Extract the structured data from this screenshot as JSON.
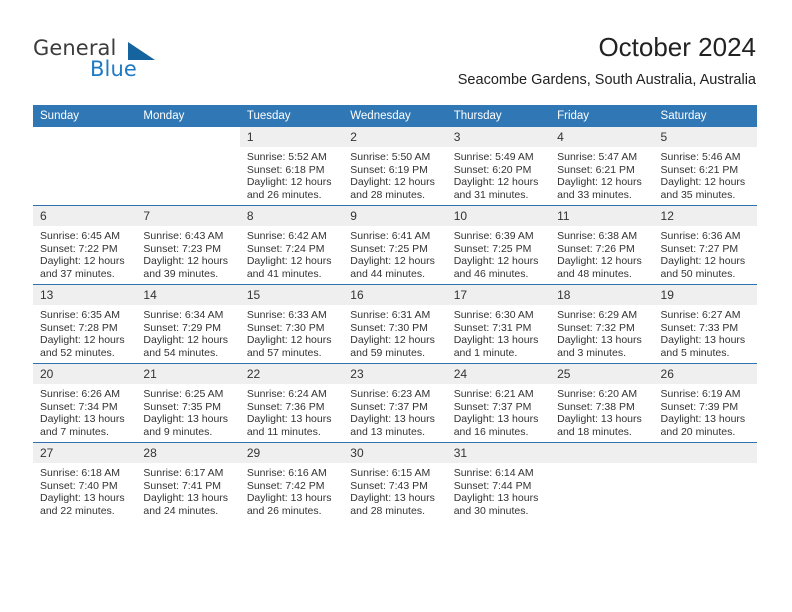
{
  "brand": {
    "name_top": "General",
    "name_bottom": "Blue",
    "accent_color": "#15639f",
    "blue_text_color": "#1f7ac4"
  },
  "header": {
    "title": "October 2024",
    "subtitle": "Seacombe Gardens, South Australia, Australia"
  },
  "theme": {
    "header_band": "#3077b5",
    "row_divider": "#2e73b0",
    "day_number_band": "#efefef"
  },
  "weekday_headers": [
    "Sunday",
    "Monday",
    "Tuesday",
    "Wednesday",
    "Thursday",
    "Friday",
    "Saturday"
  ],
  "weeks": [
    {
      "shaded_empty": false,
      "days": [
        {
          "empty": true
        },
        {
          "empty": true
        },
        {
          "day": "1",
          "sunrise": "Sunrise: 5:52 AM",
          "sunset": "Sunset: 6:18 PM",
          "daylight_line1": "Daylight: 12 hours",
          "daylight_line2": "and 26 minutes."
        },
        {
          "day": "2",
          "sunrise": "Sunrise: 5:50 AM",
          "sunset": "Sunset: 6:19 PM",
          "daylight_line1": "Daylight: 12 hours",
          "daylight_line2": "and 28 minutes."
        },
        {
          "day": "3",
          "sunrise": "Sunrise: 5:49 AM",
          "sunset": "Sunset: 6:20 PM",
          "daylight_line1": "Daylight: 12 hours",
          "daylight_line2": "and 31 minutes."
        },
        {
          "day": "4",
          "sunrise": "Sunrise: 5:47 AM",
          "sunset": "Sunset: 6:21 PM",
          "daylight_line1": "Daylight: 12 hours",
          "daylight_line2": "and 33 minutes."
        },
        {
          "day": "5",
          "sunrise": "Sunrise: 5:46 AM",
          "sunset": "Sunset: 6:21 PM",
          "daylight_line1": "Daylight: 12 hours",
          "daylight_line2": "and 35 minutes."
        }
      ]
    },
    {
      "shaded_empty": false,
      "days": [
        {
          "day": "6",
          "sunrise": "Sunrise: 6:45 AM",
          "sunset": "Sunset: 7:22 PM",
          "daylight_line1": "Daylight: 12 hours",
          "daylight_line2": "and 37 minutes."
        },
        {
          "day": "7",
          "sunrise": "Sunrise: 6:43 AM",
          "sunset": "Sunset: 7:23 PM",
          "daylight_line1": "Daylight: 12 hours",
          "daylight_line2": "and 39 minutes."
        },
        {
          "day": "8",
          "sunrise": "Sunrise: 6:42 AM",
          "sunset": "Sunset: 7:24 PM",
          "daylight_line1": "Daylight: 12 hours",
          "daylight_line2": "and 41 minutes."
        },
        {
          "day": "9",
          "sunrise": "Sunrise: 6:41 AM",
          "sunset": "Sunset: 7:25 PM",
          "daylight_line1": "Daylight: 12 hours",
          "daylight_line2": "and 44 minutes."
        },
        {
          "day": "10",
          "sunrise": "Sunrise: 6:39 AM",
          "sunset": "Sunset: 7:25 PM",
          "daylight_line1": "Daylight: 12 hours",
          "daylight_line2": "and 46 minutes."
        },
        {
          "day": "11",
          "sunrise": "Sunrise: 6:38 AM",
          "sunset": "Sunset: 7:26 PM",
          "daylight_line1": "Daylight: 12 hours",
          "daylight_line2": "and 48 minutes."
        },
        {
          "day": "12",
          "sunrise": "Sunrise: 6:36 AM",
          "sunset": "Sunset: 7:27 PM",
          "daylight_line1": "Daylight: 12 hours",
          "daylight_line2": "and 50 minutes."
        }
      ]
    },
    {
      "shaded_empty": false,
      "days": [
        {
          "day": "13",
          "sunrise": "Sunrise: 6:35 AM",
          "sunset": "Sunset: 7:28 PM",
          "daylight_line1": "Daylight: 12 hours",
          "daylight_line2": "and 52 minutes."
        },
        {
          "day": "14",
          "sunrise": "Sunrise: 6:34 AM",
          "sunset": "Sunset: 7:29 PM",
          "daylight_line1": "Daylight: 12 hours",
          "daylight_line2": "and 54 minutes."
        },
        {
          "day": "15",
          "sunrise": "Sunrise: 6:33 AM",
          "sunset": "Sunset: 7:30 PM",
          "daylight_line1": "Daylight: 12 hours",
          "daylight_line2": "and 57 minutes."
        },
        {
          "day": "16",
          "sunrise": "Sunrise: 6:31 AM",
          "sunset": "Sunset: 7:30 PM",
          "daylight_line1": "Daylight: 12 hours",
          "daylight_line2": "and 59 minutes."
        },
        {
          "day": "17",
          "sunrise": "Sunrise: 6:30 AM",
          "sunset": "Sunset: 7:31 PM",
          "daylight_line1": "Daylight: 13 hours",
          "daylight_line2": "and 1 minute."
        },
        {
          "day": "18",
          "sunrise": "Sunrise: 6:29 AM",
          "sunset": "Sunset: 7:32 PM",
          "daylight_line1": "Daylight: 13 hours",
          "daylight_line2": "and 3 minutes."
        },
        {
          "day": "19",
          "sunrise": "Sunrise: 6:27 AM",
          "sunset": "Sunset: 7:33 PM",
          "daylight_line1": "Daylight: 13 hours",
          "daylight_line2": "and 5 minutes."
        }
      ]
    },
    {
      "shaded_empty": false,
      "days": [
        {
          "day": "20",
          "sunrise": "Sunrise: 6:26 AM",
          "sunset": "Sunset: 7:34 PM",
          "daylight_line1": "Daylight: 13 hours",
          "daylight_line2": "and 7 minutes."
        },
        {
          "day": "21",
          "sunrise": "Sunrise: 6:25 AM",
          "sunset": "Sunset: 7:35 PM",
          "daylight_line1": "Daylight: 13 hours",
          "daylight_line2": "and 9 minutes."
        },
        {
          "day": "22",
          "sunrise": "Sunrise: 6:24 AM",
          "sunset": "Sunset: 7:36 PM",
          "daylight_line1": "Daylight: 13 hours",
          "daylight_line2": "and 11 minutes."
        },
        {
          "day": "23",
          "sunrise": "Sunrise: 6:23 AM",
          "sunset": "Sunset: 7:37 PM",
          "daylight_line1": "Daylight: 13 hours",
          "daylight_line2": "and 13 minutes."
        },
        {
          "day": "24",
          "sunrise": "Sunrise: 6:21 AM",
          "sunset": "Sunset: 7:37 PM",
          "daylight_line1": "Daylight: 13 hours",
          "daylight_line2": "and 16 minutes."
        },
        {
          "day": "25",
          "sunrise": "Sunrise: 6:20 AM",
          "sunset": "Sunset: 7:38 PM",
          "daylight_line1": "Daylight: 13 hours",
          "daylight_line2": "and 18 minutes."
        },
        {
          "day": "26",
          "sunrise": "Sunrise: 6:19 AM",
          "sunset": "Sunset: 7:39 PM",
          "daylight_line1": "Daylight: 13 hours",
          "daylight_line2": "and 20 minutes."
        }
      ]
    },
    {
      "shaded_empty": true,
      "days": [
        {
          "day": "27",
          "sunrise": "Sunrise: 6:18 AM",
          "sunset": "Sunset: 7:40 PM",
          "daylight_line1": "Daylight: 13 hours",
          "daylight_line2": "and 22 minutes."
        },
        {
          "day": "28",
          "sunrise": "Sunrise: 6:17 AM",
          "sunset": "Sunset: 7:41 PM",
          "daylight_line1": "Daylight: 13 hours",
          "daylight_line2": "and 24 minutes."
        },
        {
          "day": "29",
          "sunrise": "Sunrise: 6:16 AM",
          "sunset": "Sunset: 7:42 PM",
          "daylight_line1": "Daylight: 13 hours",
          "daylight_line2": "and 26 minutes."
        },
        {
          "day": "30",
          "sunrise": "Sunrise: 6:15 AM",
          "sunset": "Sunset: 7:43 PM",
          "daylight_line1": "Daylight: 13 hours",
          "daylight_line2": "and 28 minutes."
        },
        {
          "day": "31",
          "sunrise": "Sunrise: 6:14 AM",
          "sunset": "Sunset: 7:44 PM",
          "daylight_line1": "Daylight: 13 hours",
          "daylight_line2": "and 30 minutes."
        },
        {
          "empty": true
        },
        {
          "empty": true
        }
      ]
    }
  ]
}
